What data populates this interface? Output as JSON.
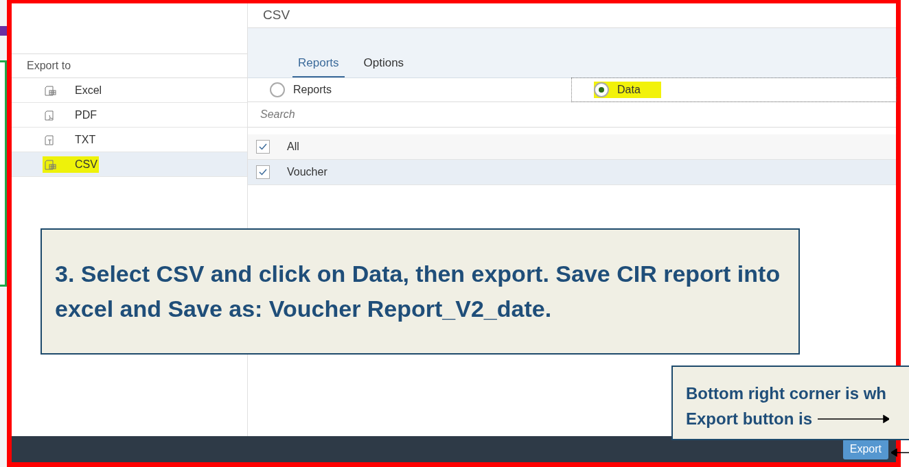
{
  "export_to": {
    "heading": "Export to",
    "items": [
      {
        "label": "Excel",
        "kind": "table",
        "selected": false,
        "highlighted": false
      },
      {
        "label": "PDF",
        "kind": "pdf",
        "selected": false,
        "highlighted": false
      },
      {
        "label": "TXT",
        "kind": "text",
        "selected": false,
        "highlighted": false
      },
      {
        "label": "CSV",
        "kind": "table",
        "selected": true,
        "highlighted": true
      }
    ]
  },
  "format_title": "CSV",
  "tabs": [
    {
      "label": "Reports",
      "selected": true
    },
    {
      "label": "Options",
      "selected": false
    }
  ],
  "radios": [
    {
      "label": "Reports",
      "selected": false,
      "highlighted": false
    },
    {
      "label": "Data",
      "selected": true,
      "highlighted": true
    }
  ],
  "search": {
    "placeholder": "Search"
  },
  "list": [
    {
      "label": "All",
      "checked": true,
      "selected": false
    },
    {
      "label": "Voucher",
      "checked": true,
      "selected": true
    }
  ],
  "export_button": "Export",
  "callouts": [
    {
      "text": "3. Select CSV and click on Data, then export. Save CIR report into excel and Save as: Voucher Report_V2_date."
    },
    {
      "lines": [
        "Bottom right corner is wh",
        "Export button is"
      ]
    }
  ]
}
